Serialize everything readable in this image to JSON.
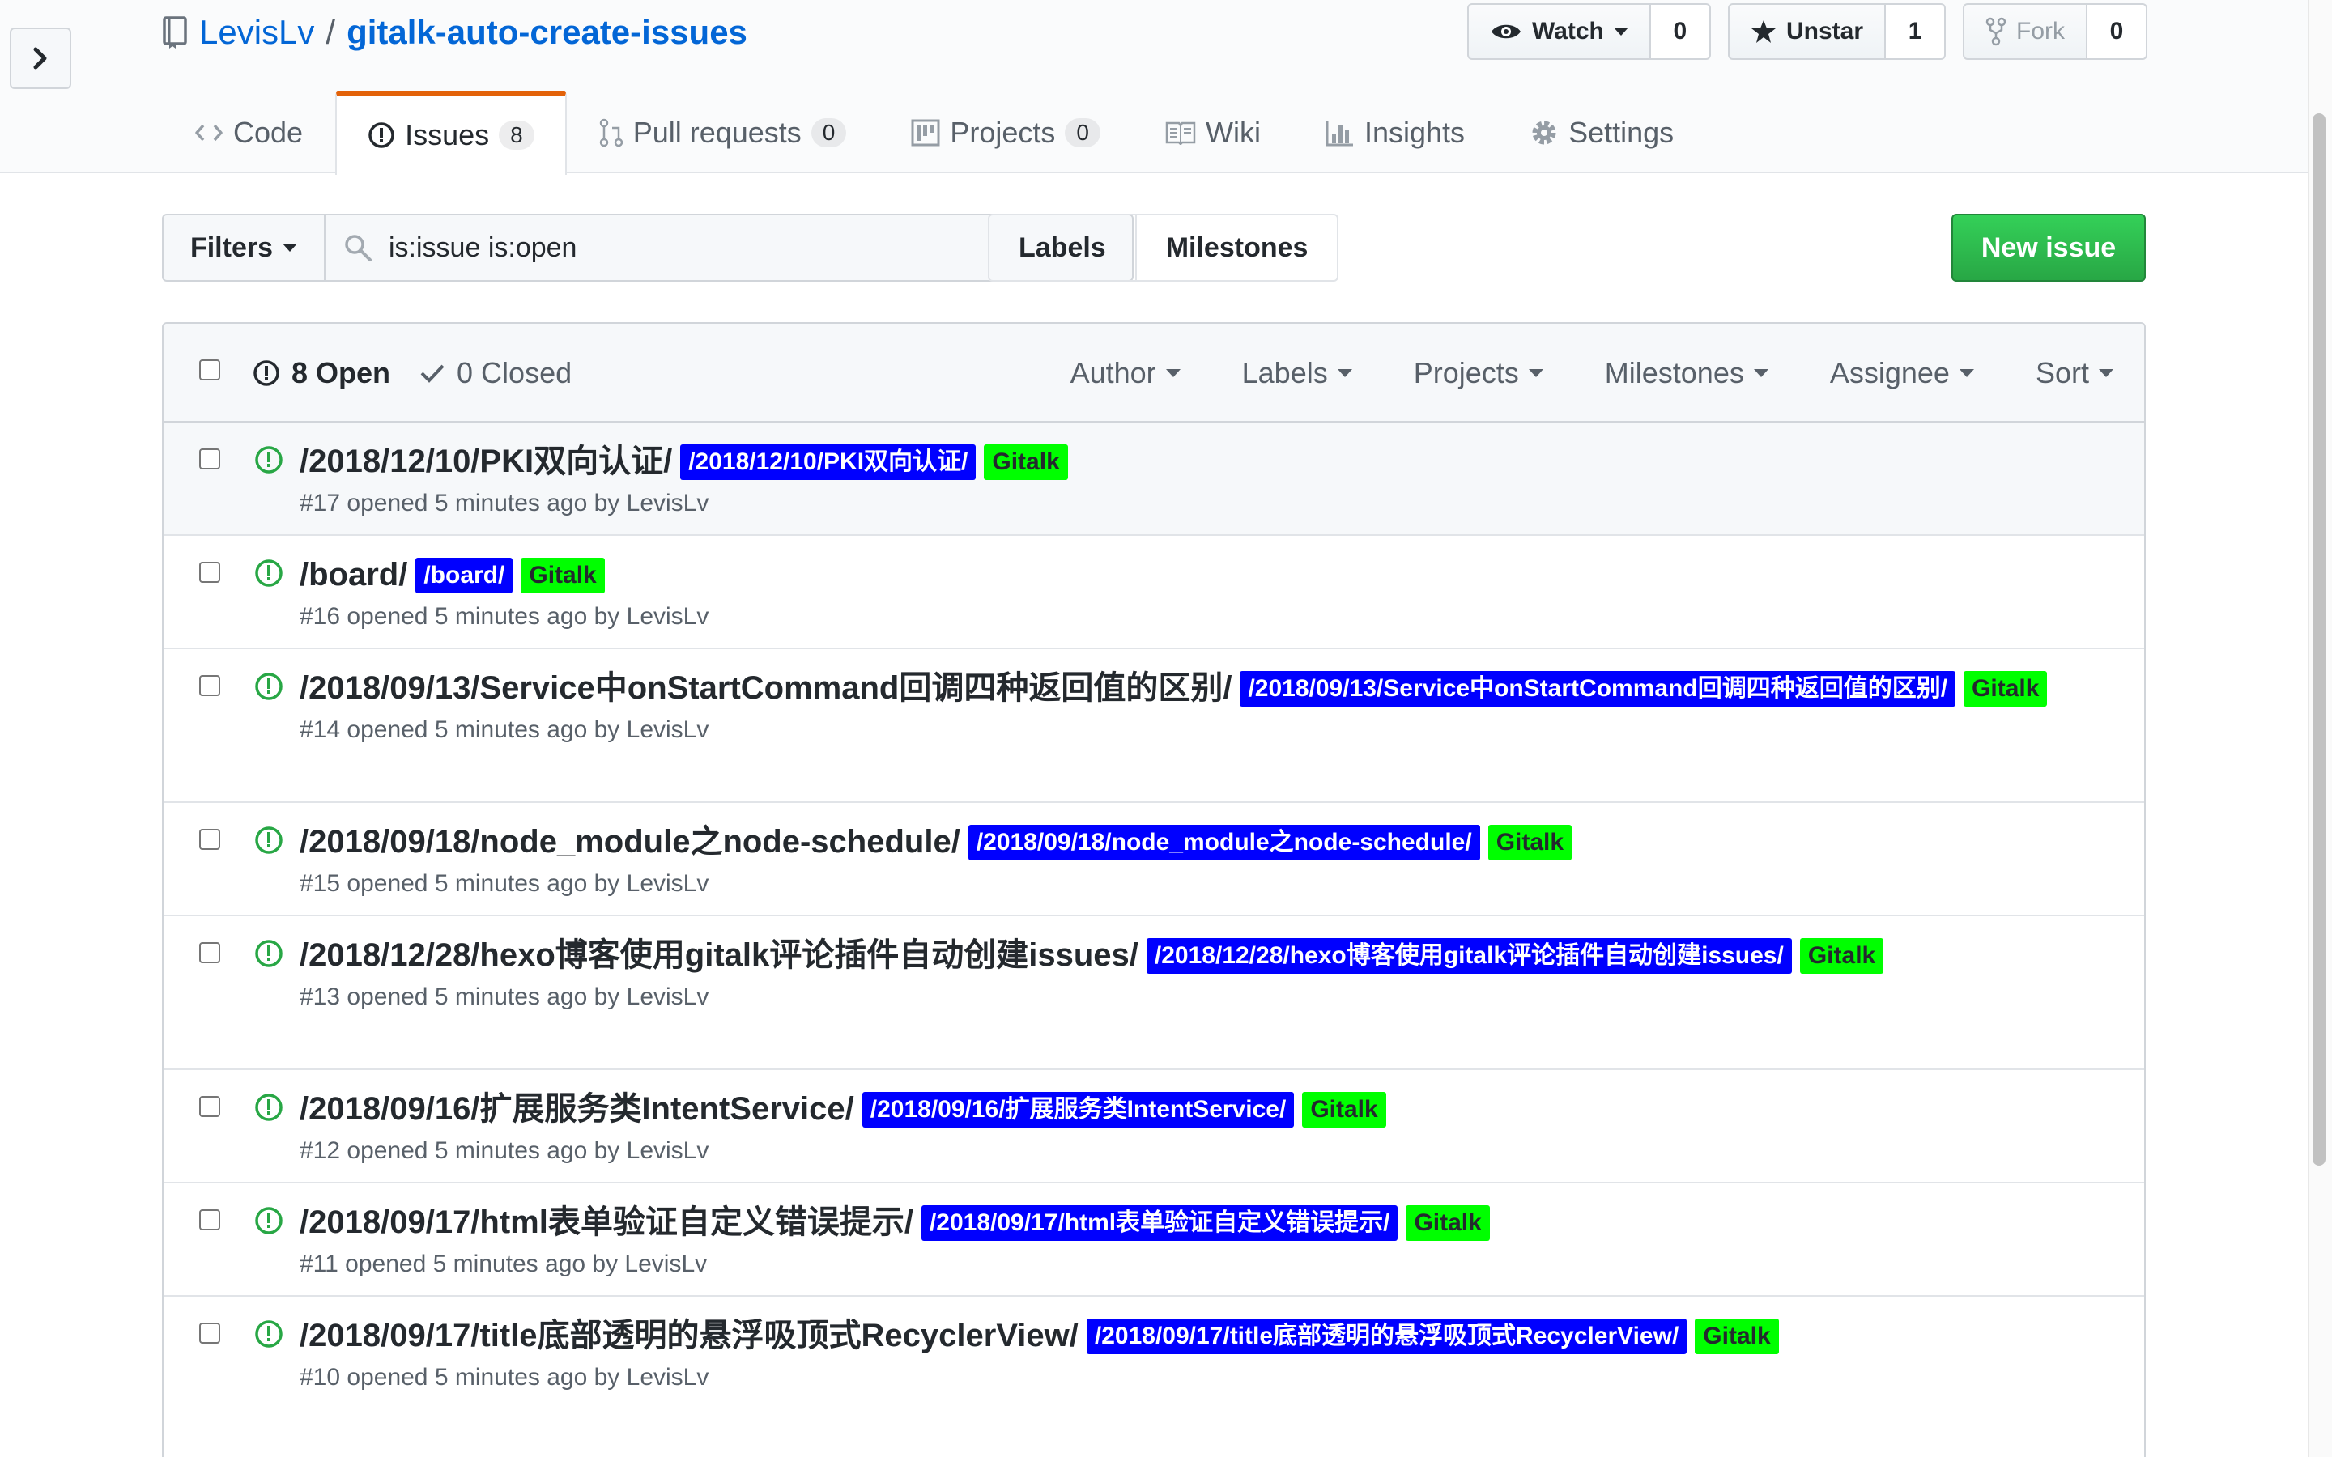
{
  "repo": {
    "owner": "LevisLv",
    "separator": "/",
    "name": "gitalk-auto-create-issues"
  },
  "actions": {
    "watch": {
      "label": "Watch",
      "count": "0"
    },
    "unstar": {
      "label": "Unstar",
      "count": "1"
    },
    "fork": {
      "label": "Fork",
      "count": "0"
    }
  },
  "nav": {
    "code": "Code",
    "issues": {
      "label": "Issues",
      "count": "8"
    },
    "pulls": {
      "label": "Pull requests",
      "count": "0"
    },
    "projects": {
      "label": "Projects",
      "count": "0"
    },
    "wiki": "Wiki",
    "insights": "Insights",
    "settings": "Settings"
  },
  "subnav": {
    "filters": "Filters",
    "search_value": "is:issue is:open",
    "labels": "Labels",
    "milestones": "Milestones",
    "new_issue": "New issue"
  },
  "header": {
    "open": "8 Open",
    "closed": "0 Closed",
    "filters": [
      "Author",
      "Labels",
      "Projects",
      "Milestones",
      "Assignee",
      "Sort"
    ]
  },
  "colors": {
    "label_blue": "#0000ff",
    "label_green": "#00ff00",
    "open_icon": "#28a745",
    "active_tab": "#e36209"
  },
  "issues": [
    {
      "title": "/2018/12/10/PKI双向认证/",
      "labels": [
        "/2018/12/10/PKI双向认证/",
        "Gitalk"
      ],
      "meta": "#17 opened 5 minutes ago by LevisLv"
    },
    {
      "title": "/board/",
      "labels": [
        "/board/",
        "Gitalk"
      ],
      "meta": "#16 opened 5 minutes ago by LevisLv"
    },
    {
      "title": "/2018/09/13/Service中onStartCommand回调四种返回值的区别/",
      "labels": [
        "/2018/09/13/Service中onStartCommand回调四种返回值的区别/",
        "Gitalk"
      ],
      "meta": "#14 opened 5 minutes ago by LevisLv"
    },
    {
      "title": "/2018/09/18/node_module之node-schedule/",
      "labels": [
        "/2018/09/18/node_module之node-schedule/",
        "Gitalk"
      ],
      "meta": "#15 opened 5 minutes ago by LevisLv"
    },
    {
      "title": "/2018/12/28/hexo博客使用gitalk评论插件自动创建issues/",
      "labels": [
        "/2018/12/28/hexo博客使用gitalk评论插件自动创建issues/",
        "Gitalk"
      ],
      "meta": "#13 opened 5 minutes ago by LevisLv"
    },
    {
      "title": "/2018/09/16/扩展服务类IntentService/",
      "labels": [
        "/2018/09/16/扩展服务类IntentService/",
        "Gitalk"
      ],
      "meta": "#12 opened 5 minutes ago by LevisLv"
    },
    {
      "title": "/2018/09/17/html表单验证自定义错误提示/",
      "labels": [
        "/2018/09/17/html表单验证自定义错误提示/",
        "Gitalk"
      ],
      "meta": "#11 opened 5 minutes ago by LevisLv"
    },
    {
      "title": "/2018/09/17/title底部透明的悬浮吸顶式RecyclerView/",
      "labels": [
        "/2018/09/17/title底部透明的悬浮吸顶式RecyclerView/",
        "Gitalk"
      ],
      "meta": "#10 opened 5 minutes ago by LevisLv"
    }
  ]
}
